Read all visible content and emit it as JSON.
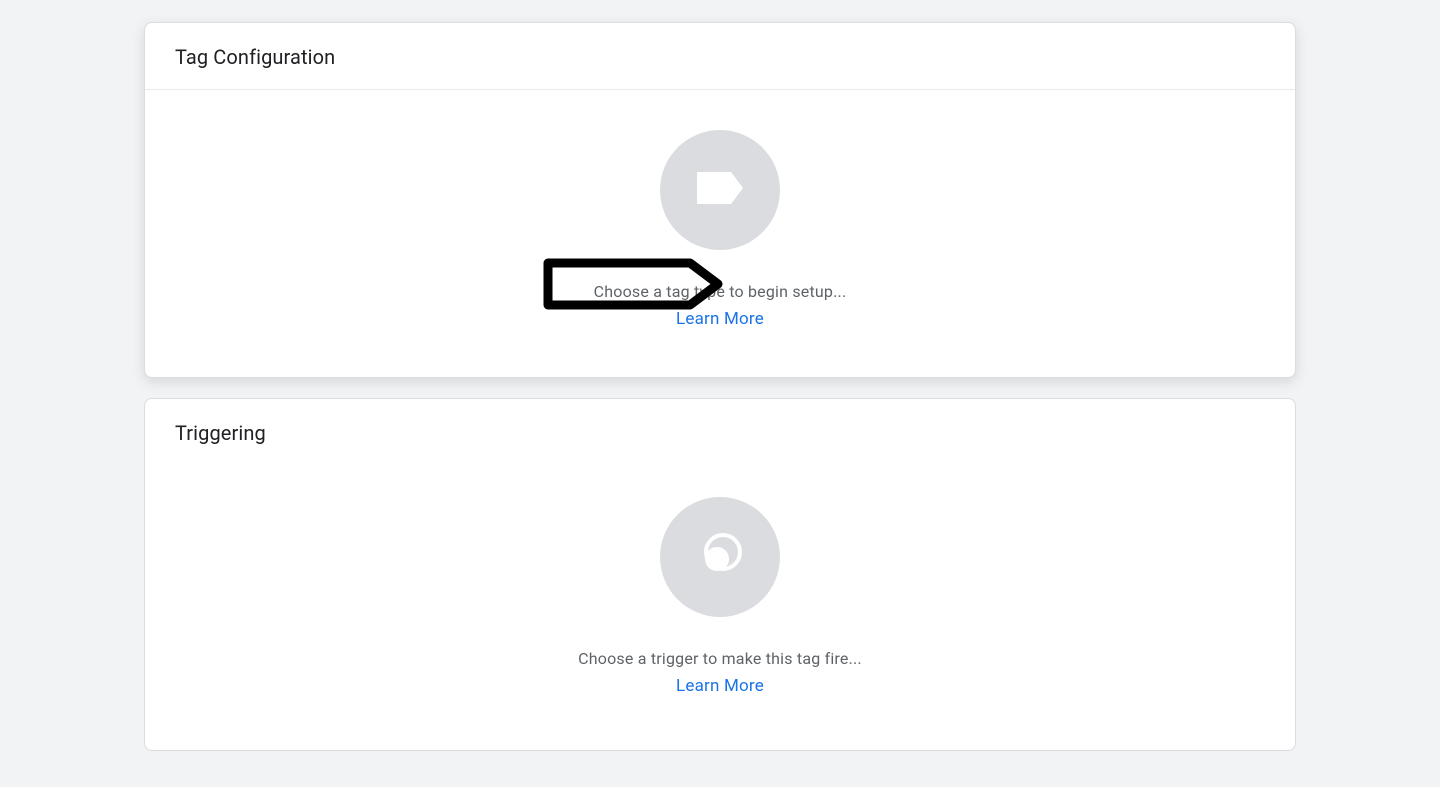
{
  "tagConfig": {
    "title": "Tag Configuration",
    "helpText": "Choose a tag type to begin setup...",
    "learnMore": "Learn More"
  },
  "triggering": {
    "title": "Triggering",
    "helpText": "Choose a trigger to make this tag fire...",
    "learnMore": "Learn More"
  }
}
